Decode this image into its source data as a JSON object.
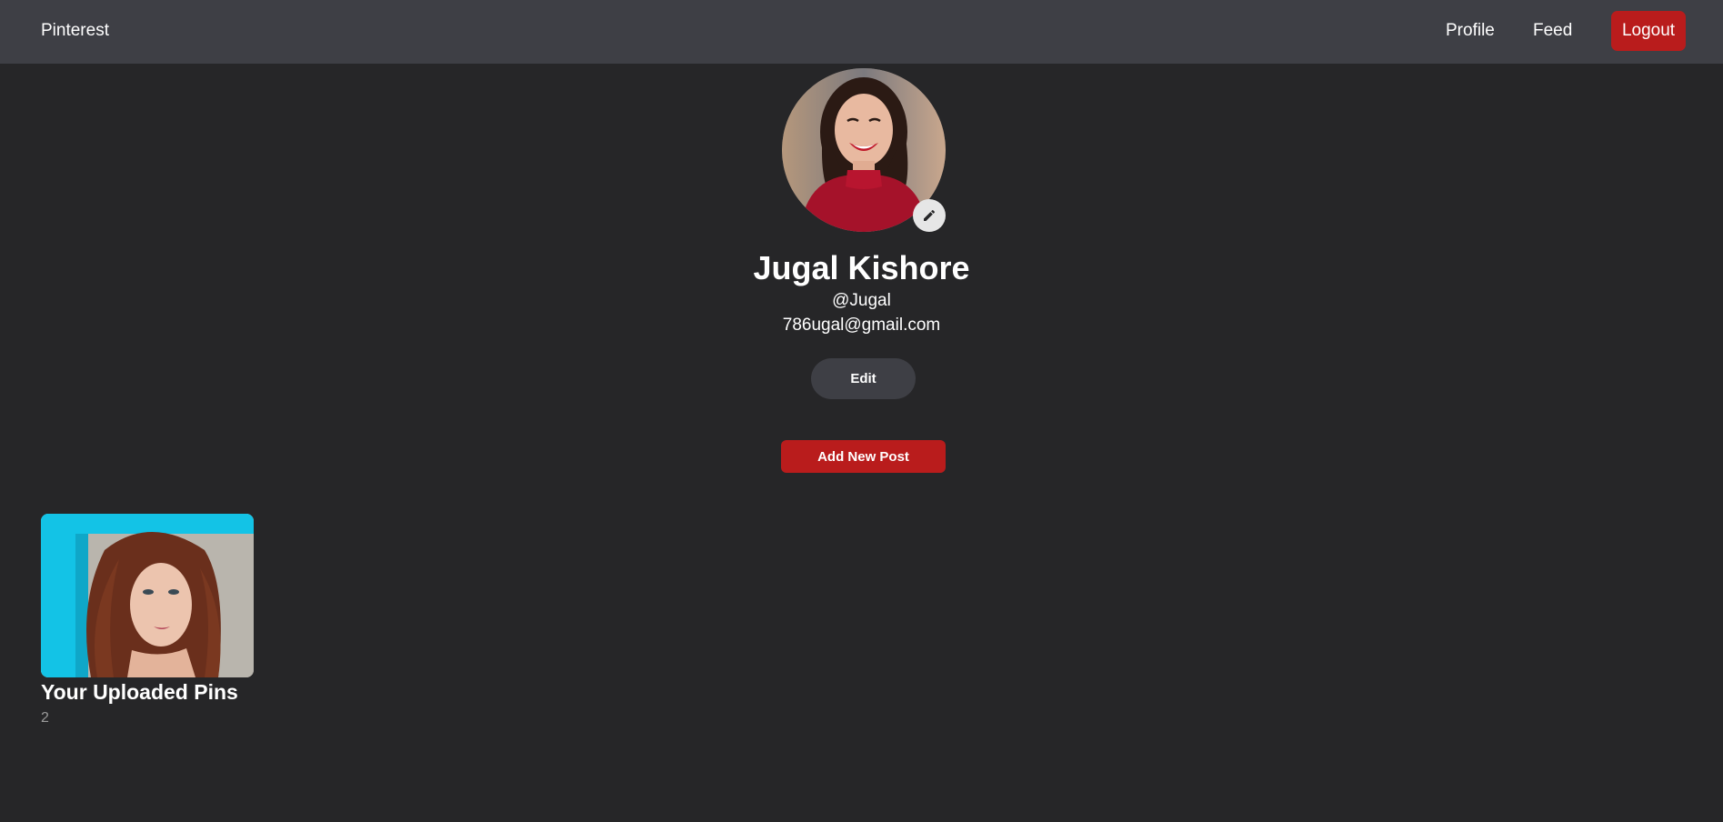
{
  "navbar": {
    "brand": "Pinterest",
    "links": [
      {
        "label": "Profile"
      },
      {
        "label": "Feed"
      }
    ],
    "logout_label": "Logout"
  },
  "profile": {
    "name": "Jugal Kishore",
    "username": "@Jugal",
    "email": "786ugal@gmail.com",
    "edit_label": "Edit",
    "edit_avatar_icon": "pencil-icon"
  },
  "actions": {
    "add_post_label": "Add New Post"
  },
  "pins": {
    "title": "Your Uploaded Pins",
    "count": "2"
  },
  "colors": {
    "background": "#262628",
    "navbar": "#3e3f45",
    "accent_red": "#b91c1c",
    "edit_button": "#3e3f45",
    "muted_text": "#9a9a9a"
  }
}
